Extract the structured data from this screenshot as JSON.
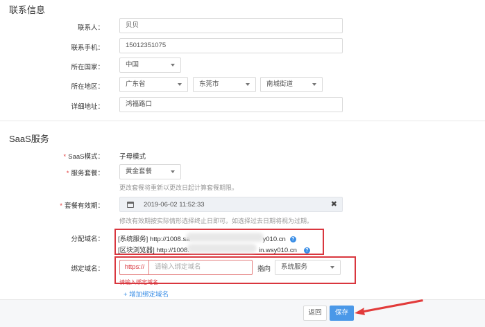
{
  "contact": {
    "section_title": "联系信息",
    "contact_person_label": "联系人：",
    "contact_person_value": "贝贝",
    "phone_label": "联系手机：",
    "phone_value": "15012351075",
    "country_label": "所在国家：",
    "country_value": "中国",
    "region_label": "所在地区：",
    "province_value": "广东省",
    "city_value": "东莞市",
    "district_value": "南城街道",
    "address_label": "详细地址：",
    "address_value": "鸿福路口"
  },
  "saas": {
    "section_title": "SaaS服务",
    "mode_label": "SaaS模式：",
    "mode_value": "子母模式",
    "package_label": "服务套餐：",
    "package_value": "黄金套餐",
    "package_hint": "更改套餐将重新以更改日起计算套餐期限。",
    "expiry_label": "套餐有效期：",
    "expiry_value": "2019-06-02 11:52:33",
    "expiry_hint": "修改有效期按实际情形选择终止日即可。如选择过去日期将视为过期。",
    "required_mark": "*",
    "assigned_domain_label": "分配域名：",
    "domain_lines": [
      "[系统服务] http://1008.sa",
      "y010.cn",
      "[区块浏览器] http://1008.",
      "in.wsy010.cn"
    ],
    "help_icon_glyph": "?",
    "bind_domain_label": "绑定域名：",
    "protocol": "https://",
    "bind_placeholder": "请输入绑定域名",
    "point_to_label": "指向",
    "point_to_value": "系统服务",
    "error_text": "请输入绑定域名",
    "add_link": "+ 增加绑定域名"
  },
  "footer": {
    "back_label": "返回",
    "save_label": "保存"
  },
  "colors": {
    "accent": "#3a8ee6",
    "error": "#d9363e",
    "annotation": "#e23b3b"
  }
}
